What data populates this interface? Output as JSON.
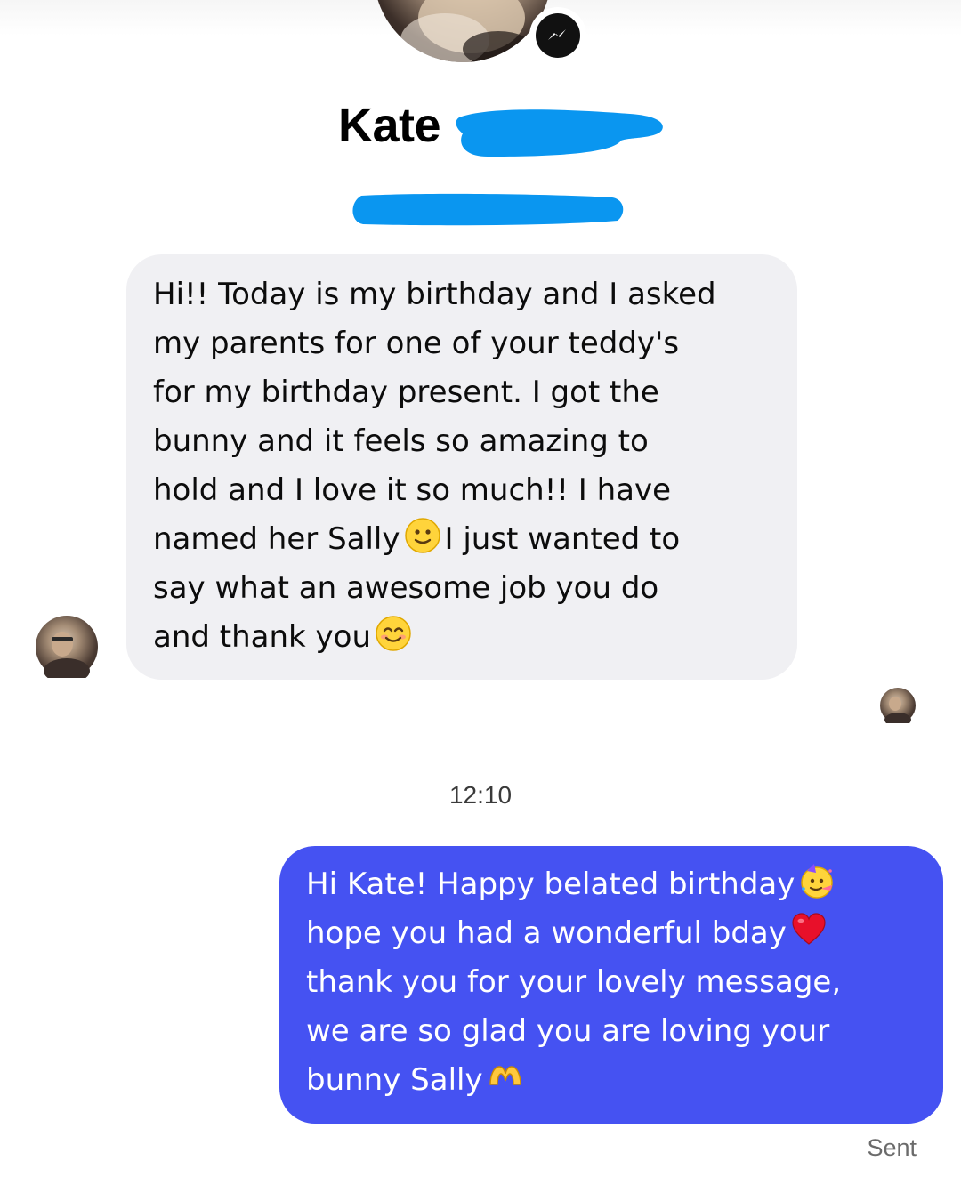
{
  "conversation": {
    "contact_name": "Kate",
    "icons": {
      "messenger_badge": "messenger-icon",
      "redaction_color": "#0a96f0"
    }
  },
  "incoming_message": {
    "lines": [
      "Hi!! Today is my birthday and I asked",
      "my parents for one of your teddy's",
      "for my birthday present.  I got the",
      "bunny and it feels so amazing to",
      "hold and I love it so much!! I have",
      "named her Sally",
      "I just wanted to",
      "say what an awesome job you do",
      "and thank you"
    ],
    "emojis": [
      "slightly-smiling-face-emoji",
      "smiling-face-with-smiling-eyes-emoji"
    ]
  },
  "timestamp": "12:10",
  "outgoing_message": {
    "lines": [
      "Hi Kate! Happy belated birthday",
      "hope you had a wonderful bday",
      "thank you for your lovely message,",
      "we are so glad you are loving your",
      "bunny Sally"
    ],
    "emojis": [
      "partying-face-emoji",
      "red-heart-emoji",
      "heart-hands-emoji"
    ]
  },
  "status": "Sent",
  "colors": {
    "incoming_bubble": "#f0f0f3",
    "outgoing_bubble": "#4552f2"
  }
}
